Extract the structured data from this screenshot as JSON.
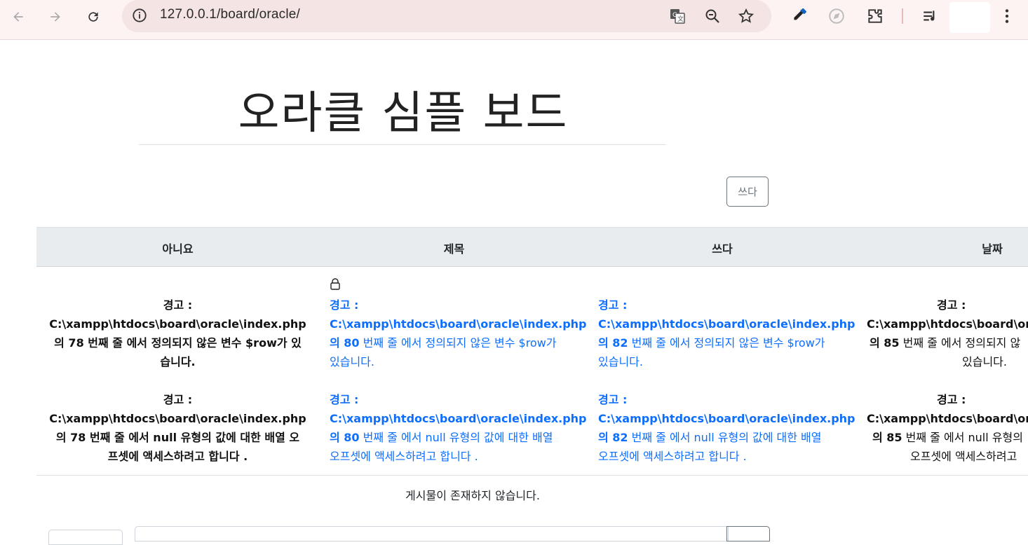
{
  "browser": {
    "url": "127.0.0.1/board/oracle/"
  },
  "page": {
    "title": "오라클 심플 보드",
    "write_button": "쓰다",
    "table": {
      "headers": [
        "아니요",
        "제목",
        "쓰다",
        "날짜"
      ]
    },
    "warnings": {
      "col1": {
        "w1": {
          "label": "경고 :",
          "path": "C:\\xampp\\htdocs\\board\\oracle\\index.php",
          "msg1": "의 78 번째 줄 에서 정의되지 않은 변수 $row가 있",
          "msg2": "습니다."
        },
        "w2": {
          "label": "경고 :",
          "path": "C:\\xampp\\htdocs\\board\\oracle\\index.php",
          "msg1": "의 78 번째 줄 에서 null 유형의 값에 대한 배열 오",
          "msg2": "프셋에 액세스하려고 합니다 ."
        }
      },
      "col2": {
        "w1": {
          "label": "경고 :",
          "path": "C:\\xampp\\htdocs\\board\\oracle\\index.php",
          "linepre": "의 80",
          "msg1": " 번째 줄 에서 정의되지 않은 변수 $row가",
          "msg2": "있습니다."
        },
        "w2": {
          "label": "경고 :",
          "path": "C:\\xampp\\htdocs\\board\\oracle\\index.php",
          "linepre": "의 80",
          "msg1": " 번째 줄 에서 null 유형의 값에 대한 배열",
          "msg2": "오프셋에 액세스하려고 합니다 ."
        }
      },
      "col3": {
        "w1": {
          "label": "경고 :",
          "path": "C:\\xampp\\htdocs\\board\\oracle\\index.php",
          "linepre": "의 82",
          "msg1": " 번째 줄 에서 정의되지 않은 변수 $row가",
          "msg2": "있습니다."
        },
        "w2": {
          "label": "경고 :",
          "path": "C:\\xampp\\htdocs\\board\\oracle\\index.php",
          "linepre": "의 82",
          "msg1": " 번째 줄 에서 null 유형의 값에 대한 배열",
          "msg2": "오프셋에 액세스하려고 합니다 ."
        }
      },
      "col4": {
        "w1": {
          "label": "경고 :",
          "path": "C:\\xampp\\htdocs\\board\\or",
          "linepre": "의 85",
          "msg1": " 번째 줄 에서 정의되지 않",
          "msg2": "있습니다."
        },
        "w2": {
          "label": "경고 :",
          "path": "C:\\xampp\\htdocs\\board\\or",
          "linepre": "의 85",
          "msg1": " 번째 줄 에서 null 유형의",
          "msg2": "오프셋에 액세스하려고"
        }
      }
    },
    "empty_message": "게시물이 존재하지 않습니다."
  },
  "icons": {
    "back": "back-arrow-icon",
    "forward": "forward-arrow-icon",
    "reload": "reload-icon",
    "info": "info-icon",
    "translate": "translate-icon",
    "zoom": "zoom-icon",
    "bookmark": "star-icon",
    "eyedropper": "eyedropper-icon",
    "compass": "compass-icon",
    "extensions": "puzzle-icon",
    "media": "media-queue-icon",
    "menu": "kebab-menu-icon",
    "lock": "lock-icon"
  },
  "colors": {
    "link_blue": "#0d6efd",
    "header_bg": "#e9ecef",
    "chrome_bg": "#fdf3f3"
  }
}
